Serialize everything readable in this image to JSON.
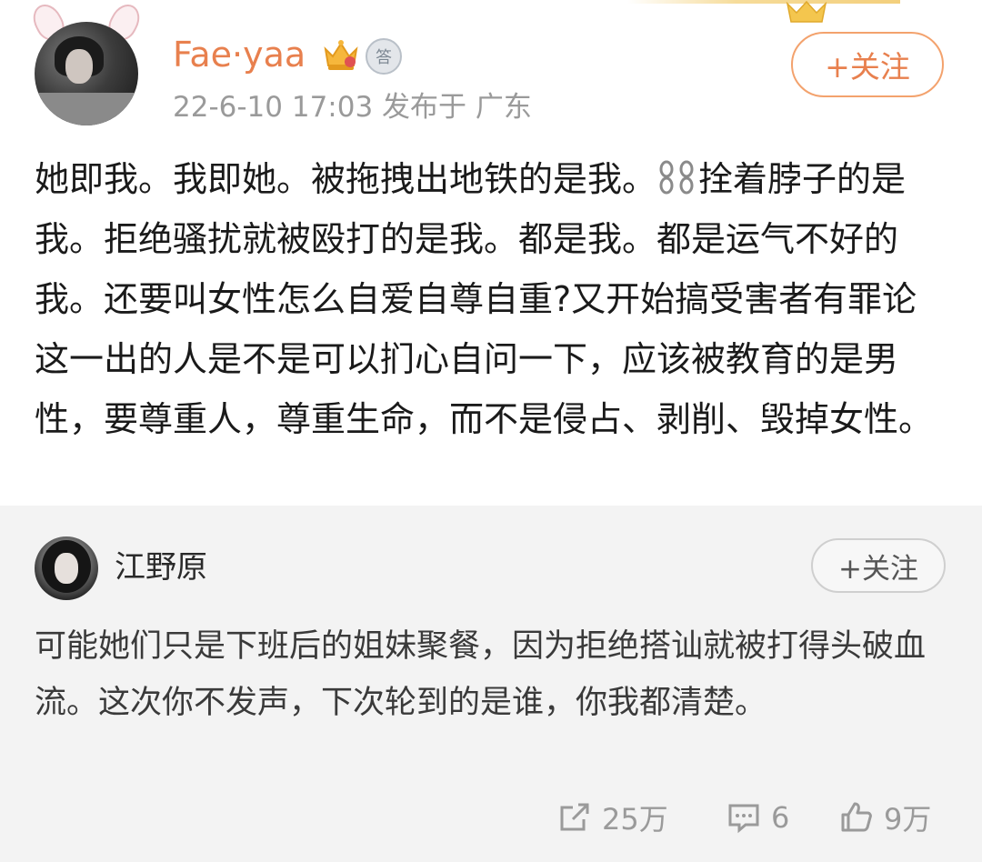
{
  "post": {
    "username": "Fae·yaa",
    "level_badge": "答",
    "meta": "22-6-10 17:03  发布于 广东",
    "follow_label": "+关注",
    "text_part1": "她即我。我即她。被拖拽出地铁的是我。",
    "text_part2": "拴着脖子的是我。拒绝骚扰就被殴打的是我。都是我。都是运气不好的我。还要叫女性怎么自爱自尊自重?又开始搞受害者有罪论这一出的人是不是可以扪心自问一下，应该被教育的是男性，要尊重人，尊重生命，而不是侵占、剥削、毁掉女性。"
  },
  "repost": {
    "username": "江野原",
    "follow_label": "+关注",
    "text": "可能她们只是下班后的姐妹聚餐，因为拒绝搭讪就被打得头破血流。这次你不发声，下次轮到的是谁，你我都清楚。",
    "actions": {
      "repost_count": "25万",
      "comment_count": "6",
      "like_count": "9万"
    }
  },
  "icons": {
    "chain": "chain-icon",
    "vip": "crown-badge-icon",
    "repost": "share-icon",
    "comment": "comment-icon",
    "like": "thumbs-up-icon"
  },
  "colors": {
    "accent": "#e8804e",
    "meta": "#9a9a9a",
    "repost_bg": "#f3f3f3"
  }
}
